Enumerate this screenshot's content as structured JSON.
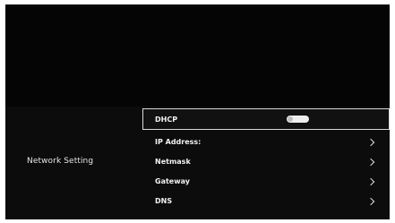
{
  "section": {
    "label": "Network Setting"
  },
  "settings": [
    {
      "label": "DHCP",
      "control": "toggle-icon",
      "toggle_on": true
    },
    {
      "label": "IP Address:",
      "control": "chevron-right-icon"
    },
    {
      "label": "Netmask",
      "control": "chevron-right-icon"
    },
    {
      "label": "Gateway",
      "control": "chevron-right-icon"
    },
    {
      "label": "DNS",
      "control": "chevron-right-icon"
    }
  ],
  "colors": {
    "background": "#050505",
    "panel": "#0c0c0c",
    "focus_border": "#d9d9d9",
    "text": "#f2f2f2"
  }
}
